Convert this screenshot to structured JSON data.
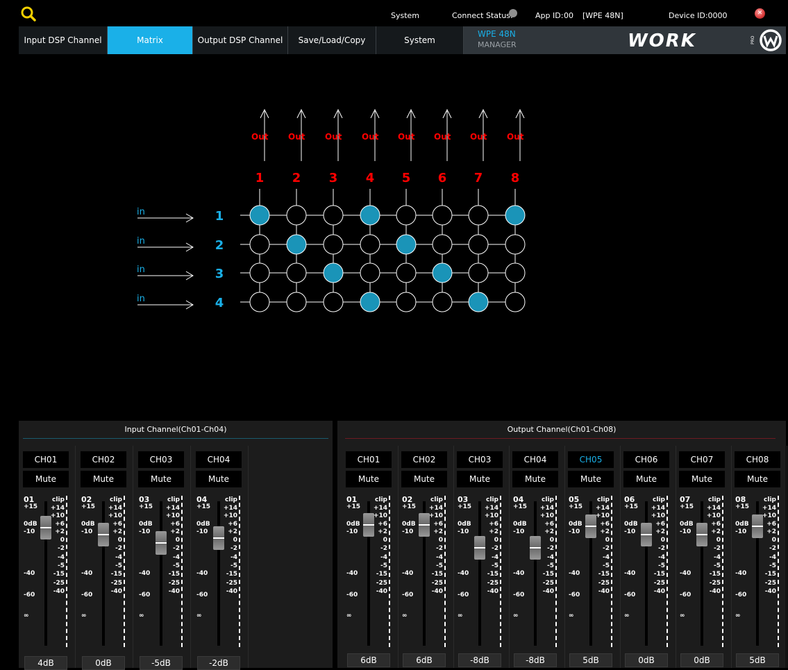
{
  "topbar": {
    "system_label": "System",
    "connect_label": "Connect Status:",
    "app_id_label": "App ID:",
    "app_id_value": "00",
    "model_tag": "[WPE 48N]",
    "device_id_label": "Device ID:0000"
  },
  "colors": {
    "accent": "#1ab0e8",
    "matrix_active": "#1a94b8",
    "out_label": "#ff0000",
    "in_label": "#1ab0e8",
    "input_line": "#1a5c6e",
    "output_line": "#6e1a22"
  },
  "tabs": [
    {
      "label": "Input DSP Channel",
      "active": false
    },
    {
      "label": "Matrix",
      "active": true
    },
    {
      "label": "Output DSP Channel",
      "active": false
    },
    {
      "label": "Save/Load/Copy",
      "active": false
    },
    {
      "label": "System",
      "active": false
    }
  ],
  "brand": {
    "title": "WPE 48N",
    "subtitle": "MANAGER",
    "logo_text": "WORK",
    "logo_sub": "PRO"
  },
  "matrix": {
    "out_label": "Out",
    "in_label": "in",
    "outputs": [
      "1",
      "2",
      "3",
      "4",
      "5",
      "6",
      "7",
      "8"
    ],
    "inputs": [
      "1",
      "2",
      "3",
      "4"
    ],
    "routing": [
      [
        1,
        0,
        0,
        1,
        0,
        0,
        0,
        1
      ],
      [
        0,
        1,
        0,
        0,
        1,
        0,
        0,
        0
      ],
      [
        0,
        0,
        1,
        0,
        0,
        1,
        0,
        0
      ],
      [
        0,
        0,
        0,
        1,
        0,
        0,
        1,
        0
      ]
    ]
  },
  "input_panel": {
    "title": "Input Channel(Ch01-Ch04)",
    "channels": [
      {
        "name": "CH01",
        "num": "01",
        "mute": "Mute",
        "value": "4dB",
        "level_db": 4
      },
      {
        "name": "CH02",
        "num": "02",
        "mute": "Mute",
        "value": "0dB",
        "level_db": 0
      },
      {
        "name": "CH03",
        "num": "03",
        "mute": "Mute",
        "value": "-5dB",
        "level_db": -5
      },
      {
        "name": "CH04",
        "num": "04",
        "mute": "Mute",
        "value": "-2dB",
        "level_db": -2
      }
    ]
  },
  "output_panel": {
    "title": "Output Channel(Ch01-Ch08)",
    "channels": [
      {
        "name": "CH01",
        "num": "01",
        "mute": "Mute",
        "value": "6dB",
        "level_db": 6,
        "selected": false
      },
      {
        "name": "CH02",
        "num": "02",
        "mute": "Mute",
        "value": "6dB",
        "level_db": 6,
        "selected": false
      },
      {
        "name": "CH03",
        "num": "03",
        "mute": "Mute",
        "value": "-8dB",
        "level_db": -8,
        "selected": false
      },
      {
        "name": "CH04",
        "num": "04",
        "mute": "Mute",
        "value": "-8dB",
        "level_db": -8,
        "selected": false
      },
      {
        "name": "CH05",
        "num": "05",
        "mute": "Mute",
        "value": "5dB",
        "level_db": 5,
        "selected": true
      },
      {
        "name": "CH06",
        "num": "06",
        "mute": "Mute",
        "value": "0dB",
        "level_db": 0,
        "selected": false
      },
      {
        "name": "CH07",
        "num": "07",
        "mute": "Mute",
        "value": "0dB",
        "level_db": 0,
        "selected": false
      },
      {
        "name": "CH08",
        "num": "08",
        "mute": "Mute",
        "value": "5dB",
        "level_db": 5,
        "selected": false
      }
    ]
  },
  "fader_scale": {
    "left": [
      "+15",
      "0dB",
      "-10",
      "-40",
      "-60",
      "∞"
    ],
    "right": [
      "clip",
      "+14",
      "+10",
      "+6",
      "+2",
      "0",
      "-2",
      "-4",
      "-5",
      "-15",
      "-25",
      "-40"
    ]
  }
}
